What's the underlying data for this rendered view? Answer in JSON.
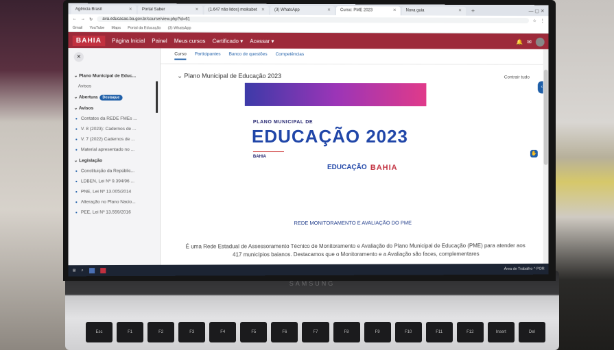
{
  "browser": {
    "tabs": [
      "Agência Brasil",
      "Portal Saber",
      "(1.647 não lidos) moikabet",
      "(3) WhatsApp",
      "Curso: PME 2023",
      "Nova guia"
    ],
    "active_tab_index": 4,
    "new_tab_glyph": "+",
    "window_controls": "—  ▢  ✕",
    "url": "ava.educacao.ba.gov.br/course/view.php?id=61",
    "bookmarks": [
      "Gmail",
      "YouTube",
      "Maps",
      "Portal da Educação",
      "(3) WhatsApp"
    ]
  },
  "navbar": {
    "logo": "BAHIA",
    "items": [
      "Página Inicial",
      "Painel",
      "Meus cursos",
      "Certificado ▾",
      "Acessar ▾"
    ]
  },
  "sidebar": {
    "close_glyph": "✕",
    "items": [
      {
        "label": "Plano Municipal de Educ...",
        "kind": "head"
      },
      {
        "label": "Avisos",
        "kind": "sub"
      },
      {
        "label": "Abertura",
        "kind": "head",
        "badge": "Destaque"
      },
      {
        "label": "Avisos",
        "kind": "head"
      },
      {
        "label": "Contatos da REDE FMEs ...",
        "kind": "bullet"
      },
      {
        "label": "V. 8 (2023): Cadernos de ...",
        "kind": "bullet"
      },
      {
        "label": "V. 7 (2022) Cadernos de ...",
        "kind": "bullet"
      },
      {
        "label": "Material apresentado no ...",
        "kind": "bullet"
      },
      {
        "label": "Legislação",
        "kind": "head"
      },
      {
        "label": "Constituição da Repúblic...",
        "kind": "bullet"
      },
      {
        "label": "LDBEN, Lei Nº 9.394/96 ...",
        "kind": "bullet"
      },
      {
        "label": "PNE, Lei Nº 13.005/2014",
        "kind": "bullet"
      },
      {
        "label": "Alteração no Plano Nacio...",
        "kind": "bullet"
      },
      {
        "label": "PEE, Lei Nº 13.559/2016",
        "kind": "bullet"
      }
    ]
  },
  "main": {
    "tabs": [
      "Curso",
      "Participantes",
      "Banco de questões",
      "Competências"
    ],
    "section_title": "Plano Municipal de Educação 2023",
    "collapse_all": "Contrair tudo",
    "banner": {
      "small": "PLANO MUNICIPAL DE",
      "big": "EDUCAÇÃO 2023",
      "state": "BAHIA",
      "logo_edu": "EDUCAÇÃO",
      "logo_bahia": "BAHIA"
    },
    "rede_title": "REDE MONITORAMENTO E AVALIAÇÃO DO PME",
    "description": "É uma Rede Estadual de Assessoramento Técnico de Monitoramento e Avaliação do Plano Municipal de Educação (PME) para atender aos 417 municípios baianos. Destacamos que o Monitoramento e a Avaliação são faces, complementares"
  },
  "taskbar": {
    "right_text": "Área de Trabalho  ^  POR"
  },
  "laptop": {
    "brand": "SAMSUNG",
    "keys": [
      "Esc",
      "F1",
      "F2",
      "F3",
      "F4",
      "F5",
      "F6",
      "F7",
      "F8",
      "F9",
      "F10",
      "F11",
      "F12",
      "Insert",
      "Del"
    ]
  }
}
